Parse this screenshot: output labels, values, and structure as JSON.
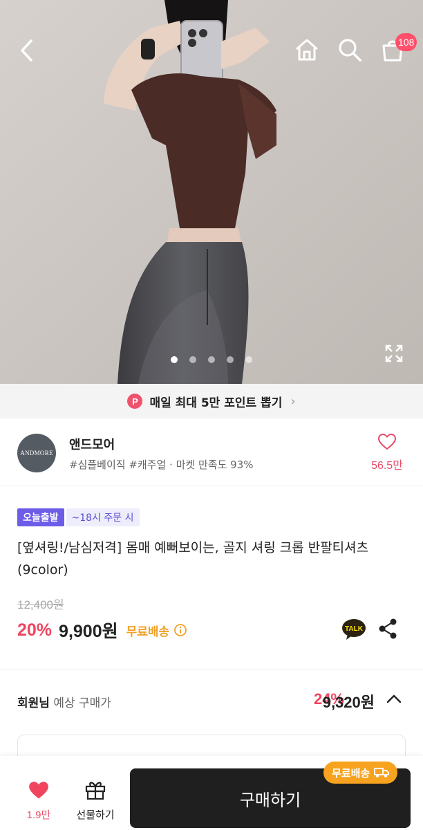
{
  "header": {
    "back_icon": "chevron-left-icon",
    "home_icon": "home-icon",
    "search_icon": "search-icon",
    "cart_icon": "cart-icon",
    "cart_count": "108"
  },
  "gallery": {
    "image_count": 5,
    "active_index": 0,
    "expand_icon": "expand-icon"
  },
  "point_banner": {
    "badge": "P",
    "text": "매일 최대 5만 포인트 뽑기"
  },
  "store": {
    "logo_text": "ANDMORE",
    "name": "앤드모어",
    "tags": "#심플베이직 #캐주얼 · 마켓 만족도 93%",
    "like_count": "56.5만"
  },
  "product": {
    "badge_today": "오늘출발",
    "badge_time": "~18시 주문 시",
    "title": "[옆셔링!/남심저격] 몸매 예뻐보이는, 골지 셔링 크롭 반팔티셔츠 (9color)",
    "original_price": "12,400원",
    "discount": "20%",
    "price": "9,900원",
    "shipping": "무료배송",
    "talk_label": "TALK"
  },
  "member_price": {
    "label_strong": "회원님",
    "label_rest": " 예상 구매가",
    "discount": "24%",
    "price": "9,320원"
  },
  "bottom_bar": {
    "like_count": "1.9만",
    "gift_label": "선물하기",
    "buy_label": "구매하기",
    "ship_badge": "무료배송"
  },
  "colors": {
    "accent_pink": "#f0445f",
    "badge_purple": "#6c5ce7",
    "shipping_orange": "#f0a12a",
    "buy_button": "#1f1f1f"
  }
}
